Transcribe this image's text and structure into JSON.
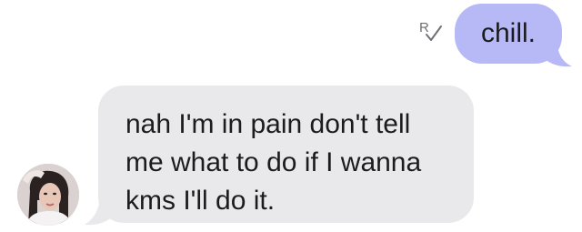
{
  "conversation": {
    "messages": [
      {
        "direction": "outgoing",
        "text": "chill.",
        "receipt_icon": "read-receipt-check-icon",
        "bubble_color": "#b7b9f6"
      },
      {
        "direction": "incoming",
        "lines": [
          "nah I'm in pain don't tell",
          "me what to do if I wanna",
          "kms I'll do it."
        ],
        "bubble_color": "#e9e9ec",
        "avatar_icon": "contact-avatar-photo"
      }
    ]
  }
}
